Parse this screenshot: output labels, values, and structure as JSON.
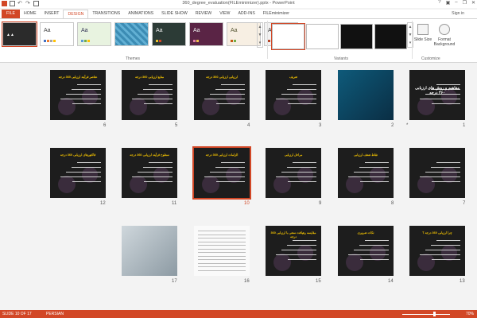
{
  "window": {
    "title": "360_degree_evaluation(FILEminimizer).pptx - PowerPoint"
  },
  "ribbon_tabs": [
    "FILE",
    "HOME",
    "INSERT",
    "DESIGN",
    "TRANSITIONS",
    "ANIMATIONS",
    "SLIDE SHOW",
    "REVIEW",
    "VIEW",
    "ADD-INS",
    "FILEminimizer"
  ],
  "active_tab": "DESIGN",
  "signin": "Sign in",
  "groups": {
    "themes": "Themes",
    "variants": "Variants",
    "customize": "Customize"
  },
  "customize": {
    "slide_size": "Slide Size",
    "format_background": "Format Background"
  },
  "slides": [
    {
      "num": "1",
      "title": "مفاهیم و روش های ارزیابی ۳۶۰ درجه",
      "star": "*"
    },
    {
      "num": "2",
      "title": "",
      "star": ""
    },
    {
      "num": "3",
      "title": "تعریف",
      "star": ""
    },
    {
      "num": "4",
      "title": "ارزیابی ارزیابی 360 درجه",
      "star": ""
    },
    {
      "num": "5",
      "title": "منابع ارزیابی 360 درجه",
      "star": ""
    },
    {
      "num": "6",
      "title": "عناصر فرآیند ارزیابی 360 درجه",
      "star": ""
    },
    {
      "num": "7",
      "title": "",
      "star": ""
    },
    {
      "num": "8",
      "title": "نقاط ضعف ارزیابی",
      "star": ""
    },
    {
      "num": "9",
      "title": "مراحل ارزیابی",
      "star": ""
    },
    {
      "num": "10",
      "title": "الزامات ارزیابی 360 درجه",
      "star": ""
    },
    {
      "num": "11",
      "title": "سطوح فرآیند ارزیابی 360 درجه",
      "star": ""
    },
    {
      "num": "12",
      "title": "فاکتورهای ارزیابی 360 درجه",
      "star": ""
    },
    {
      "num": "13",
      "title": "چرا ارزیابی 360 درجه ؟",
      "star": ""
    },
    {
      "num": "14",
      "title": "نکات ضروری",
      "star": ""
    },
    {
      "num": "15",
      "title": "مقایسه رهیافت سنتی با ارزیابی 360 درجه",
      "star": ""
    },
    {
      "num": "16",
      "title": "",
      "star": ""
    },
    {
      "num": "17",
      "title": "",
      "star": ""
    }
  ],
  "selected_slide": "10",
  "status": {
    "slide_info": "SLIDE 10 OF 17",
    "language": "PERSIAN",
    "zoom": "70%",
    "zoom_level": 0.7
  }
}
